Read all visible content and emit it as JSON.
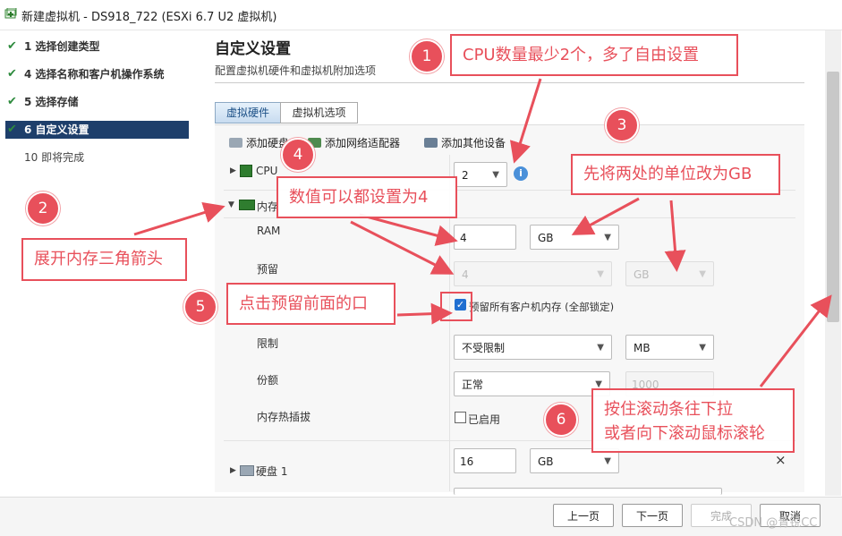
{
  "window": {
    "title": "新建虚拟机 - DS918_722 (ESXi 6.7 U2 虚拟机)"
  },
  "steps": [
    {
      "label": "1 选择创建类型",
      "state": "done"
    },
    {
      "label": "4 选择名称和客户机操作系统",
      "state": "done"
    },
    {
      "label": "5 选择存储",
      "state": "done"
    },
    {
      "label": "6 自定义设置",
      "state": "active"
    },
    {
      "label": "10 即将完成",
      "state": "pending"
    }
  ],
  "header": {
    "title": "自定义设置",
    "subtitle": "配置虚拟机硬件和虚拟机附加选项"
  },
  "tabs": [
    "虚拟硬件",
    "虚拟机选项"
  ],
  "toolbar": {
    "add_disk": "添加硬盘",
    "add_nic": "添加网络适配器",
    "add_other": "添加其他设备"
  },
  "cpu": {
    "label": "CPU",
    "value": "2"
  },
  "memory": {
    "label": "内存",
    "ram_label": "RAM",
    "ram_value": "4",
    "ram_unit": "GB",
    "reserve_label": "预留",
    "reserve_value": "4",
    "reserve_unit": "GB",
    "reserve_all_label": "预留所有客户机内存 (全部锁定)",
    "reserve_all_checked": true,
    "limit_label": "限制",
    "limit_value": "不受限制",
    "limit_unit": "MB",
    "shares_label": "份额",
    "shares_value": "正常",
    "shares_number": "1000",
    "hotplug_label": "内存热插拔",
    "hotplug_checkbox": "已启用",
    "hotplug_checked": false
  },
  "disk": {
    "label": "硬盘 1",
    "value": "16",
    "unit": "GB",
    "remove": "×"
  },
  "footer": {
    "prev": "上一页",
    "next": "下一页",
    "finish": "完成",
    "cancel": "取消"
  },
  "watermark": "CSDN @青锐CC",
  "annotations": [
    {
      "num": "1",
      "text": "CPU数量最少2个，多了自由设置"
    },
    {
      "num": "2",
      "text": "展开内存三角箭头"
    },
    {
      "num": "3",
      "text": "先将两处的单位改为GB"
    },
    {
      "num": "4",
      "text": "数值可以都设置为4"
    },
    {
      "num": "5",
      "text": "点击预留前面的口"
    },
    {
      "num": "6",
      "line1": "按住滚动条往下拉",
      "line2": "或者向下滚动鼠标滚轮"
    }
  ],
  "colors": {
    "accent": "#e8505b",
    "active_step": "#1e3f6b",
    "check": "#2e8b3e"
  }
}
